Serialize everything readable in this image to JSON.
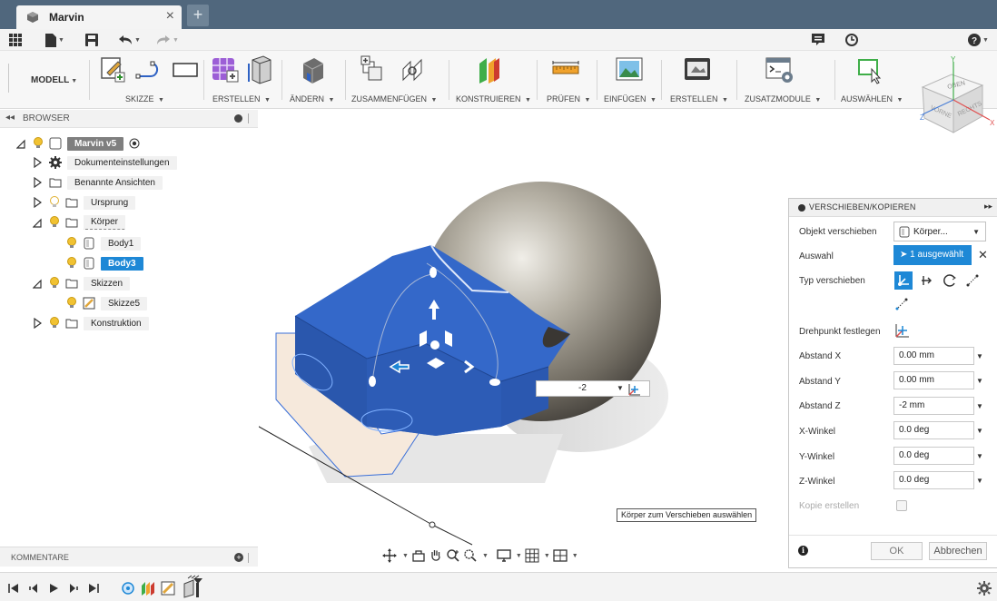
{
  "document": {
    "tab_title": "Marvin",
    "close_glyph": "×",
    "new_tab_glyph": "+"
  },
  "quick_access": {
    "icons": [
      "app-grid-icon",
      "file-icon",
      "save-icon",
      "undo-icon",
      "redo-icon",
      "notifications-icon",
      "job-status-icon",
      "help-icon"
    ]
  },
  "toolbar": {
    "mode_label": "MODELL",
    "groups": [
      {
        "name": "skizze",
        "label": "SKIZZE"
      },
      {
        "name": "erstellen",
        "label": "ERSTELLEN"
      },
      {
        "name": "aendern",
        "label": "ÄNDERN"
      },
      {
        "name": "zusammenfuegen",
        "label": "ZUSAMMENFÜGEN"
      },
      {
        "name": "konstruieren",
        "label": "KONSTRUIEREN"
      },
      {
        "name": "pruefen",
        "label": "PRÜFEN"
      },
      {
        "name": "einfuegen",
        "label": "EINFÜGEN"
      },
      {
        "name": "erstellen-2",
        "label": "ERSTELLEN"
      },
      {
        "name": "zusatzmodule",
        "label": "ZUSATZMODULE"
      },
      {
        "name": "auswaehlen",
        "label": "AUSWÄHLEN"
      }
    ]
  },
  "viewcube": {
    "top": "OBEN",
    "front": "VORNE",
    "right": "RECHTS",
    "axis_x": "X",
    "axis_y": "Y",
    "axis_z": "Z"
  },
  "browser": {
    "title": "BROWSER",
    "items": [
      {
        "label": "Marvin v5"
      },
      {
        "label": "Dokumenteinstellungen"
      },
      {
        "label": "Benannte Ansichten"
      },
      {
        "label": "Ursprung"
      },
      {
        "label": "Körper"
      },
      {
        "label": "Body1"
      },
      {
        "label": "Body3"
      },
      {
        "label": "Skizzen"
      },
      {
        "label": "Skizze5"
      },
      {
        "label": "Konstruktion"
      }
    ]
  },
  "viewport": {
    "value_input": "-2",
    "tooltip": "Körper zum Verschieben auswählen"
  },
  "panel": {
    "title": "VERSCHIEBEN/KOPIEREN",
    "rows": {
      "objekt": {
        "label": "Objekt verschieben",
        "value": "Körper..."
      },
      "auswahl": {
        "label": "Auswahl",
        "value": "1 ausgewählt"
      },
      "typ": {
        "label": "Typ verschieben"
      },
      "drehpunkt": {
        "label": "Drehpunkt festlegen"
      },
      "abstand_x": {
        "label": "Abstand X",
        "value": "0.00 mm"
      },
      "abstand_y": {
        "label": "Abstand Y",
        "value": "0.00 mm"
      },
      "abstand_z": {
        "label": "Abstand Z",
        "value": "-2 mm"
      },
      "x_winkel": {
        "label": "X-Winkel",
        "value": "0.0 deg"
      },
      "y_winkel": {
        "label": "Y-Winkel",
        "value": "0.0 deg"
      },
      "z_winkel": {
        "label": "Z-Winkel",
        "value": "0.0 deg"
      },
      "kopie": {
        "label": "Kopie erstellen"
      }
    },
    "ok_label": "OK",
    "cancel_label": "Abbrechen"
  },
  "comments": {
    "title": "KOMMENTARE"
  },
  "colors": {
    "titlebar": "#50677d",
    "accent_blue": "#1e88d6",
    "body_blue": "#2f62c4",
    "bulb_yellow": "#f1c232"
  }
}
